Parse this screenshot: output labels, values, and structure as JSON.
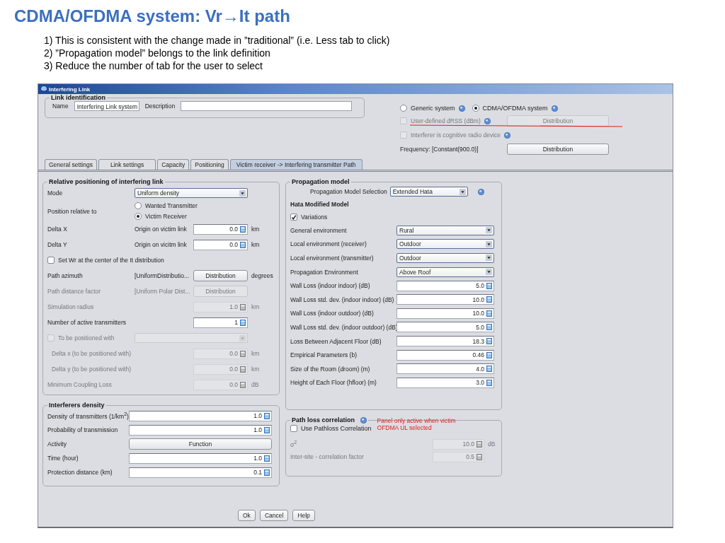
{
  "slide": {
    "title": "CDMA/OFDMA system: Vr→It path",
    "notes": [
      "1) This is consistent with the change made in ”traditional” (i.e. Less tab to click)",
      "2) ”Propagation model” belongs to the link definition",
      "3) Reduce the number of tab for the user to select"
    ]
  },
  "window": {
    "title": "Interfering Link"
  },
  "link_identification": {
    "title": "Link identification",
    "name_label": "Name",
    "name_value": "Interfering Link system",
    "description_label": "Description"
  },
  "system": {
    "options": [
      {
        "label": "Generic system",
        "selected": false
      },
      {
        "label": "CDMA/OFDMA system",
        "selected": true
      }
    ],
    "checks": [
      {
        "label": "User-defined dRSS (dBm)",
        "checked": false,
        "disabled": true,
        "struck_out": true,
        "button": "Distribution"
      },
      {
        "label": "Interferer is cognitive radio device",
        "checked": false,
        "disabled": true,
        "struck_out": false
      }
    ],
    "frequency": "Frequency: [Constant(900.0)]",
    "frequency_button": "Distribution"
  },
  "tabs": [
    {
      "label": "General settings",
      "selected": false
    },
    {
      "label": "Link settings",
      "selected": false
    },
    {
      "label": "Capacity",
      "selected": false
    },
    {
      "label": "Positioning",
      "selected": false
    },
    {
      "label": "Victim receiver -> Interfering transmitter Path",
      "selected": true
    }
  ],
  "positioning": {
    "title": "Relative positioning of interfering link",
    "rows": [
      {
        "kind": "select",
        "label": "Mode",
        "value": "Uniform density",
        "disabled": false
      },
      {
        "kind": "radios",
        "label": "Position relative to",
        "disabled": false,
        "options": [
          {
            "label": "Wanted Transmitter",
            "selected": false
          },
          {
            "label": "Victim Receiver",
            "selected": true
          }
        ]
      },
      {
        "kind": "number",
        "label": "Delta X",
        "note": "Origin on victim link",
        "value": "0.0",
        "unit": "km",
        "disabled": false
      },
      {
        "kind": "number",
        "label": "Delta Y",
        "note": "Origin on vicitm link",
        "value": "0.0",
        "unit": "km",
        "disabled": false
      },
      {
        "kind": "check",
        "label": "Set Wr at the center of the It distribution",
        "checked": false,
        "disabled": false
      },
      {
        "kind": "button",
        "label": "Path azimuth",
        "note": "[UniformDistributio...",
        "button": "Distribution",
        "unit": "degrees",
        "disabled": false
      },
      {
        "kind": "button",
        "label": "Path distance factor",
        "note": "[Uniform Polar Dist...",
        "button": "Distribution",
        "disabled": true
      },
      {
        "kind": "number",
        "label": "Simulation radius",
        "value": "1.0",
        "unit": "km",
        "disabled": true
      },
      {
        "kind": "number",
        "label": "Number of active transmitters",
        "value": "1",
        "disabled": false
      },
      {
        "kind": "check-select",
        "label": "To be positioned with",
        "checked": false,
        "disabled": true,
        "children": [
          {
            "kind": "number",
            "label": "Delta x (to be positioned with)",
            "value": "0.0",
            "unit": "km",
            "disabled": true
          },
          {
            "kind": "number",
            "label": "Delta y (to be positioned with)",
            "value": "0.0",
            "unit": "km",
            "disabled": true
          }
        ]
      },
      {
        "kind": "number",
        "label": "Minimum Coupling Loss",
        "value": "0.0",
        "unit": "dB",
        "disabled": true
      }
    ]
  },
  "density": {
    "title": "Interferers density",
    "rows": [
      {
        "kind": "number",
        "label": "Density of transmitters (1/km$^{2}$)",
        "value": "1.0"
      },
      {
        "kind": "number",
        "label": "Probability of transmission",
        "value": "1.0"
      },
      {
        "kind": "button",
        "label": "Activity",
        "button": "Function"
      },
      {
        "kind": "number",
        "label": "Time (hour)",
        "value": "1.0"
      },
      {
        "kind": "number",
        "label": "Protection distance (km)",
        "value": "0.1"
      }
    ]
  },
  "propagation": {
    "title": "Propagation model",
    "selection_label": "Propagation Model Selection",
    "selection_value": "Extended Hata",
    "model_name": "Hata Modified Model",
    "variations": {
      "label": "Variations",
      "checked": true
    },
    "rows": [
      {
        "kind": "select",
        "label": "General environment",
        "value": "Rural"
      },
      {
        "kind": "select",
        "label": "Local environment (receiver)",
        "value": "Outdoor"
      },
      {
        "kind": "select",
        "label": "Local environment (transmitter)",
        "value": "Outdoor"
      },
      {
        "kind": "select",
        "label": "Propagation Environment",
        "value": "Above Roof"
      },
      {
        "kind": "number",
        "label": "Wall Loss (indoor indoor) (dB)",
        "value": "5.0"
      },
      {
        "kind": "number",
        "label": "Wall Loss std. dev. (indoor indoor) (dB)",
        "value": "10.0"
      },
      {
        "kind": "number",
        "label": "Wall Loss (indoor outdoor) (dB)",
        "value": "10.0"
      },
      {
        "kind": "number",
        "label": "Wall Loss std. dev. (indoor outdoor) (dB)",
        "value": "5.0"
      },
      {
        "kind": "number",
        "label": "Loss Between Adjacent Floor (dB)",
        "value": "18.3"
      },
      {
        "kind": "number",
        "label": "Empirical Parameters (b)",
        "value": "0.46"
      },
      {
        "kind": "number",
        "label": "Size of the Room (droom) (m)",
        "value": "4.0"
      },
      {
        "kind": "number",
        "label": "Height of Each Floor (hfloor) (m)",
        "value": "3.0"
      }
    ]
  },
  "path_loss": {
    "title": "Path loss correlation",
    "note": "Panel only active when victim OFDMA UL selected",
    "checkbox": {
      "label": "Use Pathloss Correlation",
      "checked": false
    },
    "rows": [
      {
        "kind": "number",
        "label": "σ$^{2}$",
        "value": "10.0",
        "unit": "dB",
        "disabled": true
      },
      {
        "kind": "number",
        "label": "Inter-site - correlation factor",
        "value": "0.5",
        "disabled": true
      }
    ]
  },
  "buttons": [
    "Ok",
    "Cancel",
    "Help"
  ]
}
